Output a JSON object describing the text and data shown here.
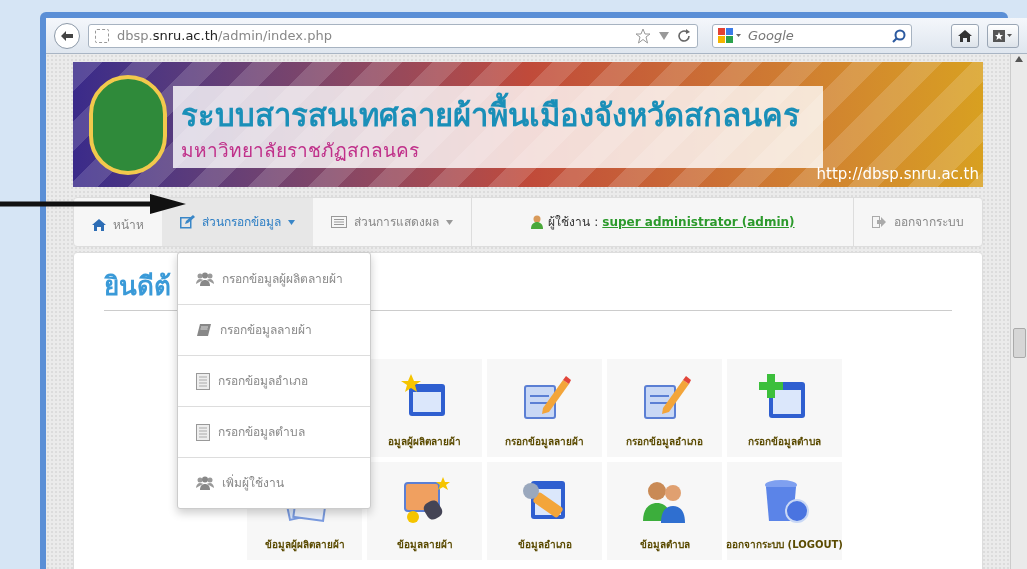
{
  "browser": {
    "url": "dbsp.**snru.ac.th**/admin/index.php",
    "search_placeholder": "Google"
  },
  "banner": {
    "title": "ระบบสารสนเทศลายผ้าพื้นเมืองจังหวัดสกลนคร",
    "subtitle": "มหาวิทยาลัยราชภัฏสกลนคร",
    "url": "http://dbsp.snru.ac.th"
  },
  "nav": {
    "items": [
      {
        "label": "หน้าห",
        "kind": "home",
        "selected": false
      },
      {
        "label": "ส่วนกรอกข้อมูล",
        "kind": "edit",
        "selected": true
      },
      {
        "label": "ส่วนการแสดงผล",
        "kind": "list",
        "selected": false
      }
    ],
    "user_label": "ผู้ใช้งาน :",
    "user_name": "super administrator (admin)",
    "logout": "ออกจากระบบ"
  },
  "dropdown": [
    {
      "label": "กรอกข้อมูลผู้ผลิตลายผ้า",
      "kind": "users"
    },
    {
      "label": "กรอกข้อมูลลายผ้า",
      "kind": "book"
    },
    {
      "label": "กรอกข้อมูลอำเภอ",
      "kind": "doc"
    },
    {
      "label": "กรอกข้อมูลตำบล",
      "kind": "doc"
    },
    {
      "label": "เพิ่มผู้ใช้งาน",
      "kind": "users"
    }
  ],
  "heading": "ยินดีต้",
  "tiles": [
    [
      {
        "label": "อมูลผู้ผลิตลายผ้า",
        "kind": "star-window"
      },
      {
        "label": "กรอกข้อมูลลายผ้า",
        "kind": "pencil-doc"
      },
      {
        "label": "กรอกข้อมูลอำเภอ",
        "kind": "pencil-doc"
      },
      {
        "label": "กรอกข้อมูลตำบล",
        "kind": "plus-window"
      }
    ],
    [
      {
        "label": "ข้อมูลผู้ผลิตลายผ้า",
        "kind": "papers"
      },
      {
        "label": "ข้อมูลลายผ้า",
        "kind": "paint"
      },
      {
        "label": "ข้อมูลอำเภอ",
        "kind": "wrench-window"
      },
      {
        "label": "ข้อมูลตำบล",
        "kind": "people"
      },
      {
        "label": "ออกจากระบบ (LOGOUT)",
        "kind": "trash"
      }
    ]
  ]
}
